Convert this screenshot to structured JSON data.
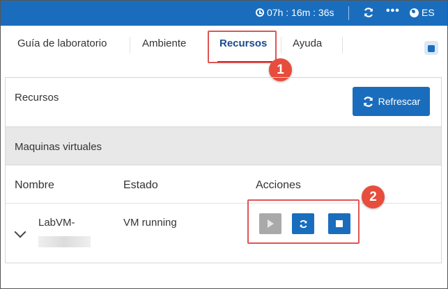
{
  "topbar": {
    "timer": "07h : 16m : 36s",
    "language": "ES",
    "bg_color": "#1a6dbd"
  },
  "tabs": [
    {
      "label": "Guía de laboratorio"
    },
    {
      "label": "Ambiente"
    },
    {
      "label": "Recursos",
      "active": true
    },
    {
      "label": "Ayuda"
    }
  ],
  "annotations": {
    "badge_1": "1",
    "badge_2": "2",
    "highlight_color": "#e05454"
  },
  "panel": {
    "title": "Recursos",
    "refresh_label": "Refrescar",
    "section_title": "Maquinas virtuales",
    "columns": {
      "name": "Nombre",
      "state": "Estado",
      "actions": "Acciones"
    },
    "rows": [
      {
        "name": "LabVM-",
        "state": "VM running"
      }
    ]
  },
  "icons": {
    "timer": "clock-icon",
    "refresh": "refresh-icon",
    "more": "dots-icon",
    "language": "globe-icon",
    "start": "play-icon",
    "restart": "restart-icon",
    "stop": "stop-icon",
    "expand": "chevron-down-icon"
  }
}
